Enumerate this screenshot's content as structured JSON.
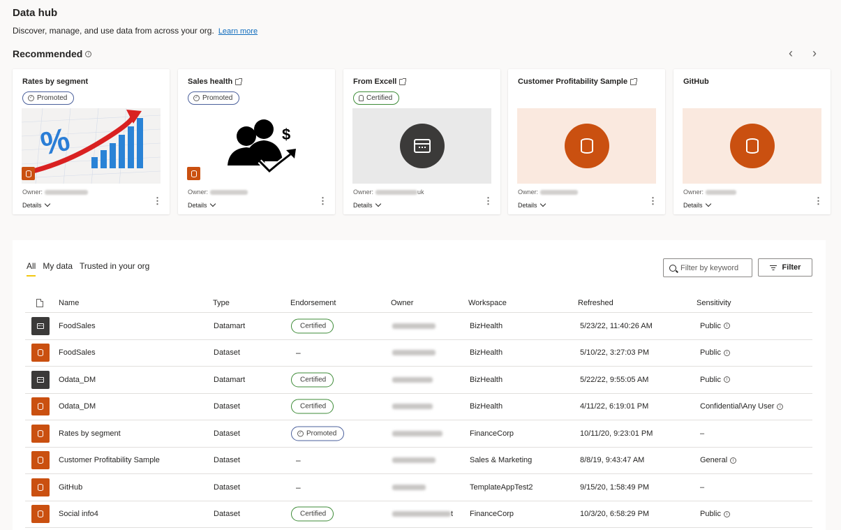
{
  "header": {
    "title": "Data hub",
    "subtitle": "Discover, manage, and use data from across your org.",
    "learn_more": "Learn more"
  },
  "recommended": {
    "title": "Recommended",
    "prev": "‹",
    "next": "›",
    "cards": [
      {
        "title": "Rates by segment",
        "badge": "Promoted",
        "owner_label": "Owner:",
        "details": "Details",
        "more": "⋮",
        "image": "chart-growth"
      },
      {
        "title": "Sales health",
        "badge": "Promoted",
        "owner_label": "Owner:",
        "details": "Details",
        "more": "⋮",
        "image": "business-people"
      },
      {
        "title": "From Excell",
        "badge": "Certified",
        "owner_label": "Owner:",
        "owner_suffix": "uk",
        "details": "Details",
        "more": "⋮",
        "image": "datamart"
      },
      {
        "title": "Customer Profitability Sample",
        "badge": "",
        "owner_label": "Owner:",
        "details": "Details",
        "more": "⋮",
        "image": "dataset"
      },
      {
        "title": "GitHub",
        "badge": "",
        "owner_label": "Owner:",
        "details": "Details",
        "more": "⋮",
        "image": "dataset"
      }
    ]
  },
  "tabs": [
    "All",
    "My data",
    "Trusted in your org"
  ],
  "search": {
    "placeholder": "Filter by keyword"
  },
  "filter_label": "Filter",
  "table": {
    "headers": [
      "Name",
      "Type",
      "Endorsement",
      "Owner",
      "Workspace",
      "Refreshed",
      "Sensitivity"
    ],
    "rows": [
      {
        "name": "FoodSales",
        "type": "Datamart",
        "endorsement": "Certified",
        "workspace": "BizHealth",
        "refreshed": "5/23/22, 11:40:26 AM",
        "sensitivity": "Public"
      },
      {
        "name": "FoodSales",
        "type": "Dataset",
        "endorsement": "–",
        "workspace": "BizHealth",
        "refreshed": "5/10/22, 3:27:03 PM",
        "sensitivity": "Public"
      },
      {
        "name": "Odata_DM",
        "type": "Datamart",
        "endorsement": "Certified",
        "workspace": "BizHealth",
        "refreshed": "5/22/22, 9:55:05 AM",
        "sensitivity": "Public"
      },
      {
        "name": "Odata_DM",
        "type": "Dataset",
        "endorsement": "Certified",
        "workspace": "BizHealth",
        "refreshed": "4/11/22, 6:19:01 PM",
        "sensitivity": "Confidential\\Any User"
      },
      {
        "name": "Rates by segment",
        "type": "Dataset",
        "endorsement": "Promoted",
        "workspace": "FinanceCorp",
        "refreshed": "10/11/20, 9:23:01 PM",
        "sensitivity": "–"
      },
      {
        "name": "Customer Profitability Sample",
        "type": "Dataset",
        "endorsement": "–",
        "workspace": "Sales & Marketing",
        "refreshed": "8/8/19, 9:43:47 AM",
        "sensitivity": "General"
      },
      {
        "name": "GitHub",
        "type": "Dataset",
        "endorsement": "–",
        "workspace": "TemplateAppTest2",
        "refreshed": "9/15/20, 1:58:49 PM",
        "sensitivity": "–"
      },
      {
        "name": "Social info4",
        "type": "Dataset",
        "endorsement": "Certified",
        "owner_suffix": "t",
        "workspace": "FinanceCorp",
        "refreshed": "10/3/20, 6:58:29 PM",
        "sensitivity": "Public"
      }
    ]
  },
  "colors": {
    "accent": "#f2c811",
    "dataset": "#ca5010",
    "datamart": "#3b3a39",
    "certified": "#3d8b37",
    "promoted": "#4a5f9b",
    "link": "#0f6cbd"
  }
}
